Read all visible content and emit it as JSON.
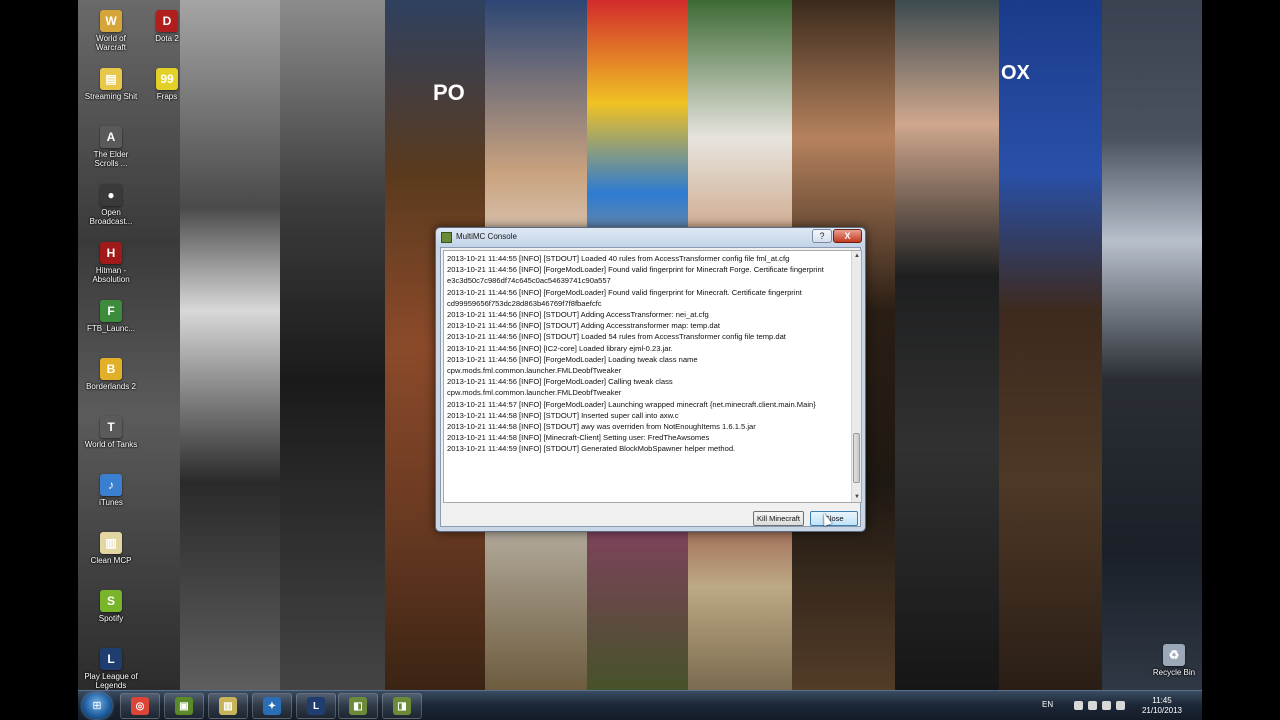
{
  "desktop": {
    "wallpaper_signs": {
      "left_sign": "PO",
      "right_sign": "OX"
    },
    "icons": [
      {
        "label": "World of Warcraft",
        "color": "#d6a53a",
        "glyph": "W"
      },
      {
        "label": "Dota 2",
        "color": "#b01e1e",
        "glyph": "D"
      },
      {
        "label": "Streaming Shit",
        "color": "#e8c84a",
        "glyph": "▤"
      },
      {
        "label": "Fraps",
        "color": "#e3d12a",
        "glyph": "99"
      },
      {
        "label": "The Elder Scrolls ...",
        "color": "#5a5a5a",
        "glyph": "A"
      },
      {
        "label": "Open Broadcast...",
        "color": "#3a3a3a",
        "glyph": "●"
      },
      {
        "label": "Hitman - Absolution",
        "color": "#a11a1a",
        "glyph": "H"
      },
      {
        "label": "FTB_Launc...",
        "color": "#3c8c3c",
        "glyph": "F"
      },
      {
        "label": "Borderlands 2",
        "color": "#e2b028",
        "glyph": "B"
      },
      {
        "label": "World of Tanks",
        "color": "#5a5a5a",
        "glyph": "T"
      },
      {
        "label": "iTunes",
        "color": "#3a7fd0",
        "glyph": "♪"
      },
      {
        "label": "Clean MCP",
        "color": "#e3d6a0",
        "glyph": "▥"
      },
      {
        "label": "Spotify",
        "color": "#78b52b",
        "glyph": "S"
      },
      {
        "label": "Play League of Legends",
        "color": "#1f3d6e",
        "glyph": "L"
      },
      {
        "label": "Recycle Bin",
        "color": "#9aa8b8",
        "glyph": "♻"
      }
    ]
  },
  "console_window": {
    "title": "MultiMC Console",
    "help_button": "?",
    "close_button": "X",
    "log_lines": [
      "2013-10-21 11:44:55 [INFO] [STDOUT] Loaded 40 rules from AccessTransformer config file fml_at.cfg",
      "2013-10-21 11:44:56 [INFO] [ForgeModLoader] Found valid fingerprint for Minecraft Forge. Certificate fingerprint e3c3d50c7c986df74c645c0ac54639741c90a557",
      "2013-10-21 11:44:56 [INFO] [ForgeModLoader] Found valid fingerprint for Minecraft. Certificate fingerprint cd99959656f753dc28d863b46769f7f8fbaefcfc",
      "2013-10-21 11:44:56 [INFO] [STDOUT] Adding AccessTransformer: nei_at.cfg",
      "2013-10-21 11:44:56 [INFO] [STDOUT] Adding Accesstransformer map: temp.dat",
      "2013-10-21 11:44:56 [INFO] [STDOUT] Loaded 54 rules from AccessTransformer config file temp.dat",
      "2013-10-21 11:44:56 [INFO] [IC2-core] Loaded library ejml-0.23.jar.",
      "2013-10-21 11:44:56 [INFO] [ForgeModLoader] Loading tweak class name cpw.mods.fml.common.launcher.FMLDeobfTweaker",
      "2013-10-21 11:44:56 [INFO] [ForgeModLoader] Calling tweak class cpw.mods.fml.common.launcher.FMLDeobfTweaker",
      "2013-10-21 11:44:57 [INFO] [ForgeModLoader] Launching wrapped minecraft {net.minecraft.client.main.Main}",
      "2013-10-21 11:44:58 [INFO] [STDOUT] Inserted super call into axw.c",
      "2013-10-21 11:44:58 [INFO] [STDOUT] awy was overriden from NotEnoughItems 1.6.1.5.jar",
      "2013-10-21 11:44:58 [INFO] [Minecraft-Client] Setting user: FredTheAwsomes",
      "2013-10-21 11:44:59 [INFO] [STDOUT] Generated BlockMobSpawner helper method."
    ],
    "kill_button": "Kill Minecraft",
    "close_label": "Close"
  },
  "taskbar": {
    "start_label": "⊞",
    "apps": [
      {
        "name": "chrome",
        "color": "#db4437",
        "glyph": "◎"
      },
      {
        "name": "minecraft",
        "color": "#5a8a2a",
        "glyph": "▣"
      },
      {
        "name": "clean-mcp",
        "color": "#c7b35a",
        "glyph": "▥"
      },
      {
        "name": "app-blue",
        "color": "#2a6fb5",
        "glyph": "✦"
      },
      {
        "name": "league",
        "color": "#1f3d6e",
        "glyph": "L"
      },
      {
        "name": "multimc",
        "color": "#6b8a3a",
        "glyph": "◧"
      },
      {
        "name": "multimc-console",
        "color": "#6b8a3a",
        "glyph": "◨"
      }
    ],
    "language": "EN",
    "time": "11:45",
    "date": "21/10/2013"
  }
}
